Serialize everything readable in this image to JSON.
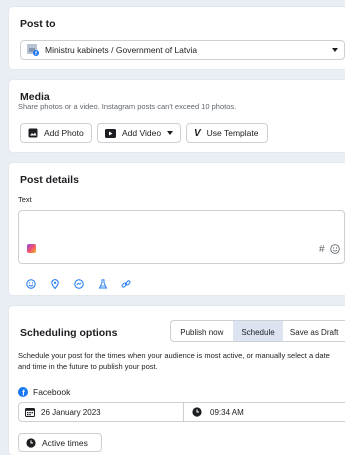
{
  "post_to": {
    "title": "Post to",
    "account": "Ministru kabinets / Government of Latvia"
  },
  "media": {
    "title": "Media",
    "description": "Share photos or a video. Instagram posts can't exceed 10 photos.",
    "add_photo": "Add Photo",
    "add_video": "Add Video",
    "use_template": "Use Template"
  },
  "post_details": {
    "title": "Post details",
    "text_label": "Text",
    "text_value": "",
    "hashtag": "#"
  },
  "scheduling": {
    "title": "Scheduling options",
    "options": [
      "Publish now",
      "Schedule",
      "Save as Draft"
    ],
    "selected": "Schedule",
    "description": "Schedule your post for the times when your audience is most active, or manually select a date and time in the future to publish your post.",
    "platform": "Facebook",
    "date": "26 January 2023",
    "time": "09:34 AM",
    "active_times": "Active times"
  },
  "colors": {
    "accent": "#1877f2",
    "page_bg": "#e9eef4",
    "selected_segment": "#dce4f2"
  }
}
